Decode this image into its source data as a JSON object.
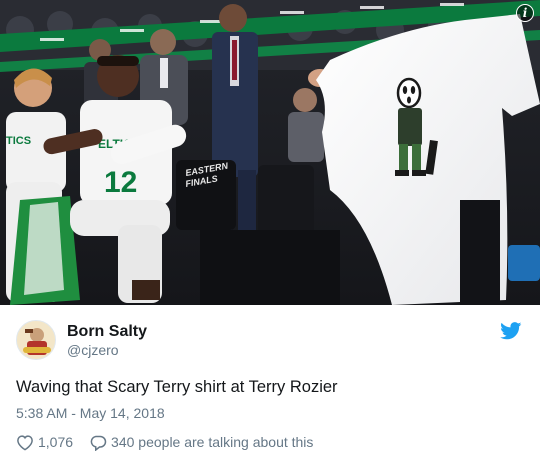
{
  "tweet": {
    "display_name": "Born Salty",
    "handle": "@cjzero",
    "text": "Waving that Scary Terry shirt at Terry Rozier",
    "timestamp": "5:38 AM - May 14, 2018",
    "like_count": "1,076",
    "reply_summary": "340 people are talking about this"
  },
  "media": {
    "jersey_text": "ELTICS",
    "jersey_number": "12",
    "chair_text": "EASTERN FINALS"
  },
  "colors": {
    "twitter_blue": "#1da1f2",
    "text_primary": "#14171a",
    "text_secondary": "#657786",
    "court_green": "#0b7a3e"
  },
  "icons": {
    "bird": "twitter-bird-icon",
    "like": "heart-icon",
    "reply": "speech-bubble-icon",
    "info": "info-icon"
  }
}
